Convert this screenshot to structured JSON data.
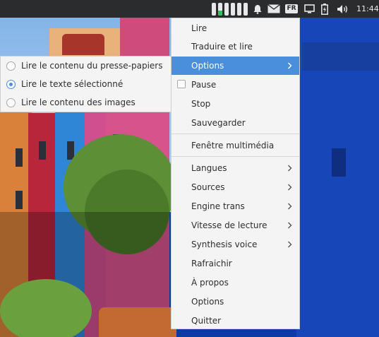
{
  "clock": "11:44",
  "tray": {
    "icons": [
      "sound-level-meter-icon",
      "notification-bell-icon",
      "mail-icon",
      "fr-speech-icon",
      "display-icon",
      "battery-icon",
      "volume-icon"
    ],
    "lang_badge": "FR"
  },
  "menu": {
    "items": [
      {
        "label": "Lire"
      },
      {
        "label": "Traduire et lire"
      },
      {
        "label": "Options",
        "submenu": true,
        "active": true
      },
      {
        "label": "Pause",
        "checkbox": true,
        "checked": false
      },
      {
        "label": "Stop"
      },
      {
        "label": "Sauvegarder"
      },
      {
        "label": "Fenêtre multimédia"
      },
      {
        "label": "Langues",
        "submenu": true
      },
      {
        "label": "Sources",
        "submenu": true
      },
      {
        "label": "Engine trans",
        "submenu": true
      },
      {
        "label": "Vitesse de lecture",
        "submenu": true
      },
      {
        "label": "Synthesis voice",
        "submenu": true
      },
      {
        "label": "Rafraichir"
      },
      {
        "label": "À propos"
      },
      {
        "label": "Options"
      },
      {
        "label": "Quitter"
      }
    ]
  },
  "submenu": {
    "items": [
      {
        "label": "Lire le contenu du presse-papiers",
        "selected": false
      },
      {
        "label": "Lire le texte sélectionné",
        "selected": true
      },
      {
        "label": "Lire le contenu des images",
        "selected": false
      }
    ]
  },
  "colors": {
    "highlight": "#4a8fdb",
    "panel": "#2b2c2e",
    "menu_bg": "#f4f4f4",
    "meter_active": "#33c05a"
  }
}
